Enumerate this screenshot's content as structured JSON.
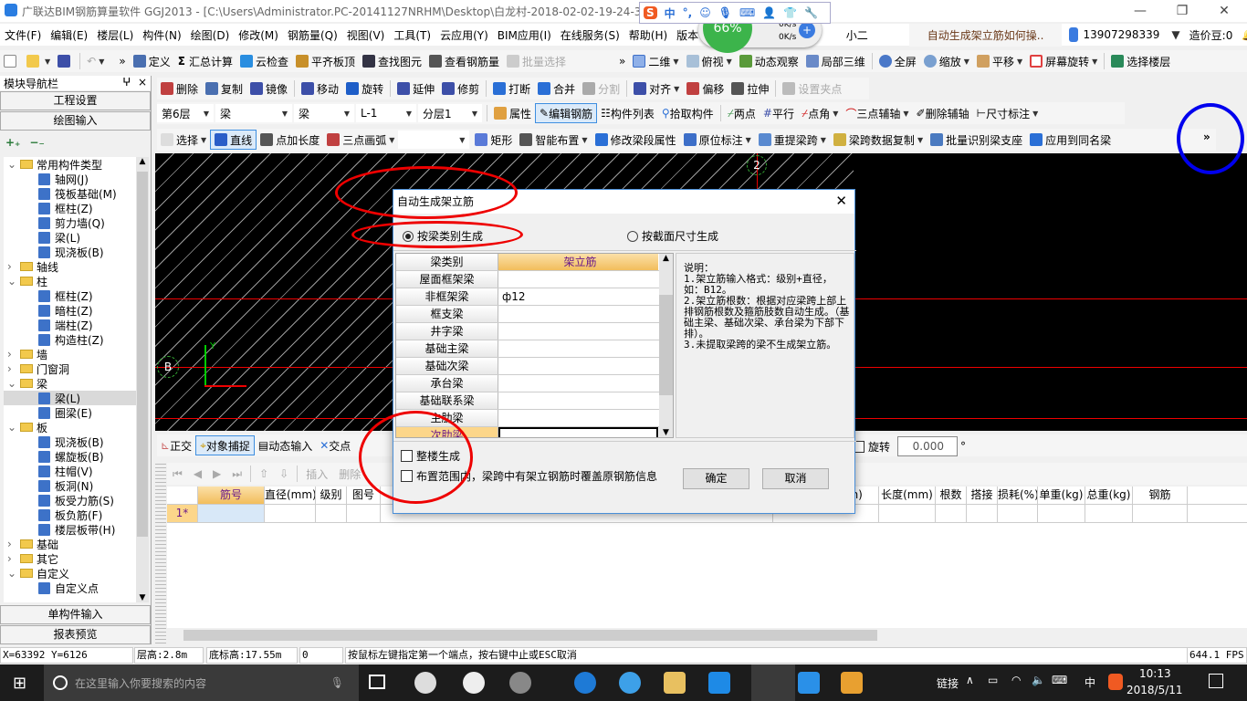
{
  "window": {
    "title": "广联达BIM钢筋算量软件 GGJ2013 - [C:\\Users\\Administrator.PC-20141127NRHM\\Desktop\\白龙村-2018-02-02-19-24-35"
  },
  "ime": {
    "items": [
      "中",
      "°,",
      "☺",
      "mic",
      "kbd",
      "user",
      "shirt",
      "wrench"
    ]
  },
  "netmon": {
    "percent": "66%",
    "up": "0K/s",
    "down": "0K/s"
  },
  "menu": [
    "文件(F)",
    "编辑(E)",
    "楼层(L)",
    "构件(N)",
    "绘图(D)",
    "修改(M)",
    "钢筋量(Q)",
    "视图(V)",
    "工具(T)",
    "云应用(Y)",
    "BIM应用(I)",
    "在线服务(S)",
    "帮助(H)",
    "版本号(B)"
  ],
  "menu_extra": {
    "assistant": "小二",
    "help_link": "自动生成架立筋如何操..",
    "account": "13907298339",
    "beans": "造价豆:0"
  },
  "toolbar1": [
    "定义",
    "汇总计算",
    "云检查",
    "平齐板顶",
    "查找图元",
    "查看钢筋量",
    "批量选择"
  ],
  "toolbar1b": [
    "二维",
    "俯视",
    "动态观察",
    "局部三维",
    "全屏",
    "缩放",
    "平移",
    "屏幕旋转",
    "选择楼层"
  ],
  "toolbar2": [
    "删除",
    "复制",
    "镜像",
    "移动",
    "旋转",
    "延伸",
    "修剪",
    "打断",
    "合并",
    "分割",
    "对齐",
    "偏移",
    "拉伸",
    "设置夹点"
  ],
  "toolbar3": {
    "selects": [
      "第6层",
      "梁",
      "梁",
      "L-1",
      "分层1"
    ],
    "items": [
      "属性",
      "编辑钢筋",
      "构件列表",
      "拾取构件",
      "两点",
      "平行",
      "点角",
      "三点辅轴",
      "删除辅轴",
      "尺寸标注"
    ]
  },
  "toolbar4": [
    "选择",
    "直线",
    "点加长度",
    "三点画弧",
    "矩形",
    "智能布置",
    "修改梁段属性",
    "原位标注",
    "重提梁跨",
    "梁跨数据复制",
    "批量识别梁支座",
    "应用到同名梁"
  ],
  "nav": {
    "title": "模块导航栏",
    "pin": "ᵖ",
    "close": "×",
    "btn_project": "工程设置",
    "btn_draw": "绘图输入",
    "btn_single": "单构件输入",
    "btn_report": "报表预览",
    "tree": [
      {
        "t": "常用构件类型",
        "lvl": 0,
        "folder": true,
        "open": true
      },
      {
        "t": "轴网(J)",
        "lvl": 1
      },
      {
        "t": "筏板基础(M)",
        "lvl": 1
      },
      {
        "t": "框柱(Z)",
        "lvl": 1
      },
      {
        "t": "剪力墙(Q)",
        "lvl": 1
      },
      {
        "t": "梁(L)",
        "lvl": 1
      },
      {
        "t": "现浇板(B)",
        "lvl": 1
      },
      {
        "t": "轴线",
        "lvl": 0,
        "folder": true
      },
      {
        "t": "柱",
        "lvl": 0,
        "folder": true,
        "open": true
      },
      {
        "t": "框柱(Z)",
        "lvl": 1
      },
      {
        "t": "暗柱(Z)",
        "lvl": 1
      },
      {
        "t": "端柱(Z)",
        "lvl": 1
      },
      {
        "t": "构造柱(Z)",
        "lvl": 1
      },
      {
        "t": "墙",
        "lvl": 0,
        "folder": true
      },
      {
        "t": "门窗洞",
        "lvl": 0,
        "folder": true
      },
      {
        "t": "梁",
        "lvl": 0,
        "folder": true,
        "open": true
      },
      {
        "t": "梁(L)",
        "lvl": 1,
        "selected": true
      },
      {
        "t": "圈梁(E)",
        "lvl": 1
      },
      {
        "t": "板",
        "lvl": 0,
        "folder": true,
        "open": true
      },
      {
        "t": "现浇板(B)",
        "lvl": 1
      },
      {
        "t": "螺旋板(B)",
        "lvl": 1
      },
      {
        "t": "柱帽(V)",
        "lvl": 1
      },
      {
        "t": "板洞(N)",
        "lvl": 1
      },
      {
        "t": "板受力筋(S)",
        "lvl": 1
      },
      {
        "t": "板负筋(F)",
        "lvl": 1
      },
      {
        "t": "楼层板带(H)",
        "lvl": 1
      },
      {
        "t": "基础",
        "lvl": 0,
        "folder": true
      },
      {
        "t": "其它",
        "lvl": 0,
        "folder": true
      },
      {
        "t": "自定义",
        "lvl": 0,
        "folder": true,
        "open": true
      },
      {
        "t": "自定义点",
        "lvl": 1
      }
    ]
  },
  "canvas": {
    "axis_b": "B",
    "axis_2": "2",
    "y_label": "Y"
  },
  "dialog": {
    "title": "自动生成架立筋",
    "radio1": "按梁类别生成",
    "radio2": "按截面尺寸生成",
    "col1": "梁类别",
    "col2": "架立筋",
    "rows": [
      [
        "屋面框架梁",
        ""
      ],
      [
        "非框架梁",
        "ф12"
      ],
      [
        "框支梁",
        ""
      ],
      [
        "井字梁",
        ""
      ],
      [
        "基础主梁",
        ""
      ],
      [
        "基础次梁",
        ""
      ],
      [
        "承台梁",
        ""
      ],
      [
        "基础联系梁",
        ""
      ],
      [
        "主肋梁",
        ""
      ],
      [
        "次肋梁",
        ""
      ]
    ],
    "note": "说明：\n1.架立筋输入格式：级别+直径，如：B12。\n2.架立筋根数：根据对应梁跨上部上排钢筋根数及箍筋肢数自动生成。（基础主梁、基础次梁、承台梁为下部下排）。\n3.未提取梁跨的梁不生成架立筋。",
    "check1": "整楼生成",
    "check2": "布置范围内，梁跨中有架立钢筋时覆盖原钢筋信息",
    "ok": "确定",
    "cancel": "取消"
  },
  "bottombar": {
    "items": [
      "正交",
      "对象捕捉",
      "动态输入",
      "交点"
    ],
    "rotate_label": "旋转",
    "rotate_value": "0.000",
    "deg": "°"
  },
  "gridbar": [
    "插入",
    "删除"
  ],
  "grid": {
    "headers": [
      "",
      "筋号",
      "直径(mm)",
      "级别",
      "图号",
      "",
      "弯曲调整(mm)",
      "长度(mm)",
      "根数",
      "搭接",
      "损耗(%)",
      "单重(kg)",
      "总重(kg)",
      "钢筋"
    ],
    "row1": "1*"
  },
  "status": {
    "coords": "X=63392 Y=6126",
    "floor_h": "层高:2.8m",
    "base_h": "底标高:17.55m",
    "num": "0",
    "hint": "按鼠标左键指定第一个端点，按右键中止或ESC取消",
    "fps": "644.1 FPS"
  },
  "taskbar": {
    "search": "在这里输入你要搜索的内容",
    "link": "链接",
    "ime": "中",
    "time": "10:13",
    "date": "2018/5/11"
  },
  "colors": {
    "accent": "#3d8ee0",
    "annotation_red": "#e00000",
    "annotation_blue": "#0000ee",
    "header_orange": "#f5c26b"
  }
}
